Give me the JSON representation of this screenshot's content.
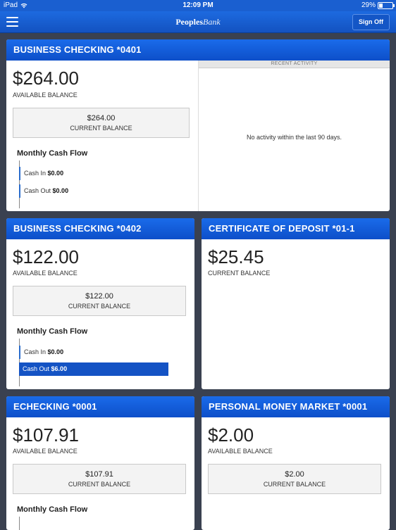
{
  "status": {
    "device": "iPad",
    "time": "12:09 PM",
    "battery": "29%",
    "battery_level": 0.29
  },
  "nav": {
    "brand_bold": "Peoples",
    "brand_script": "Bank",
    "signoff_label": "Sign Off"
  },
  "accounts": [
    {
      "title": "BUSINESS CHECKING *0401",
      "available": "$264.00",
      "available_label": "AVAILABLE BALANCE",
      "current": "$264.00",
      "current_label": "CURRENT BALANCE",
      "cash_flow": {
        "title": "Monthly Cash Flow",
        "in_label": "Cash In",
        "in": "$0.00",
        "out_label": "Cash Out",
        "out": "$0.00"
      },
      "activity": {
        "header": "RECENT ACTIVITY",
        "message": "No activity within the last 90 days."
      }
    },
    {
      "title": "BUSINESS CHECKING *0402",
      "available": "$122.00",
      "available_label": "AVAILABLE BALANCE",
      "current": "$122.00",
      "current_label": "CURRENT BALANCE",
      "cash_flow": {
        "title": "Monthly Cash Flow",
        "in_label": "Cash In",
        "in": "$0.00",
        "out_label": "Cash Out",
        "out": "$6.00"
      }
    },
    {
      "title": "CERTIFICATE OF DEPOSIT *01-1",
      "current": "$25.45",
      "current_label": "CURRENT BALANCE"
    },
    {
      "title": "ECHECKING *0001",
      "available": "$107.91",
      "available_label": "AVAILABLE BALANCE",
      "current": "$107.91",
      "current_label": "CURRENT BALANCE",
      "cash_flow": {
        "title": "Monthly Cash Flow"
      }
    },
    {
      "title": "PERSONAL MONEY MARKET *0001",
      "available": "$2.00",
      "available_label": "AVAILABLE BALANCE",
      "current": "$2.00",
      "current_label": "CURRENT BALANCE"
    }
  ]
}
